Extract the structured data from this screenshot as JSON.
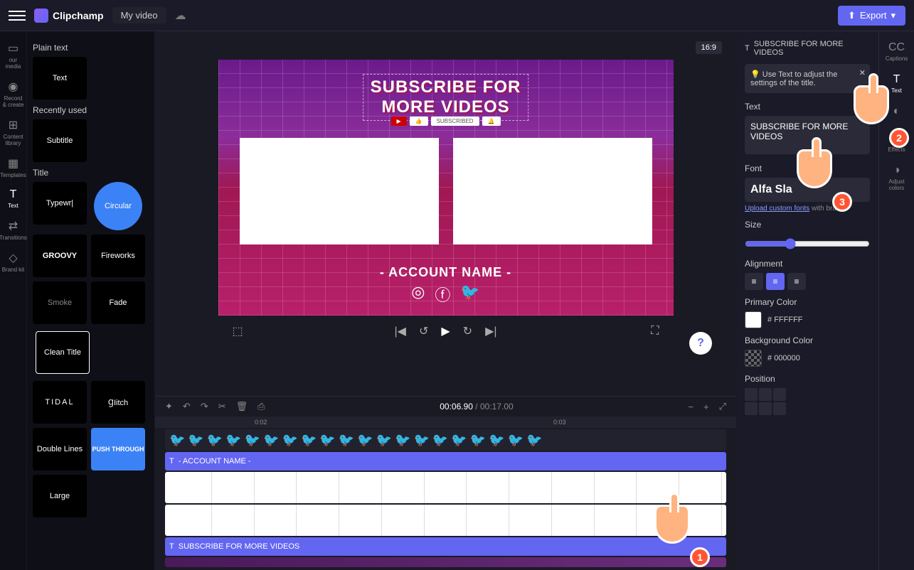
{
  "topbar": {
    "brand": "Clipchamp",
    "video_title": "My video",
    "export": "Export"
  },
  "left_rail": [
    {
      "label": "our media"
    },
    {
      "label": "Record & create"
    },
    {
      "label": "Content library"
    },
    {
      "label": "Templates"
    },
    {
      "label": "Text"
    },
    {
      "label": "Transitions"
    },
    {
      "label": "Brand kit"
    }
  ],
  "text_panel": {
    "sections": {
      "plain": "Plain text",
      "recent": "Recently used",
      "title": "Title"
    },
    "tiles": {
      "text": "Text",
      "subtitle": "Subtitle",
      "typewriter": "Typewr|",
      "circular": "Circular",
      "groovy": "GROOVY",
      "fireworks": "Fireworks",
      "smoke": "Smoke",
      "fade": "Fade",
      "clean": "Clean Title",
      "tidal": "TIDAL",
      "glitch": "ꞬIitch",
      "double": "Double Lines",
      "push": "PUSH THROUGH",
      "large": "Large"
    }
  },
  "preview": {
    "aspect": "16:9",
    "title": "SUBSCRIBE FOR\nMORE VIDEOS",
    "subscribed": "SUBSCRIBED",
    "account": "- ACCOUNT NAME -"
  },
  "player": {
    "current_time": "00:06.90",
    "total_time": "00:17.00",
    "sep": " / "
  },
  "timeline": {
    "marks": {
      "m1": "0:02",
      "m2": "0:03"
    },
    "track_account": "- ACCOUNT NAME -",
    "track_subscribe": "SUBSCRIBE FOR MORE VIDEOS"
  },
  "right_panel": {
    "header": "SUBSCRIBE FOR MORE VIDEOS",
    "tip": "Use Text to adjust the settings of the title.",
    "labels": {
      "text": "Text",
      "font": "Font",
      "upload_fonts": "Upload custom fonts",
      "upload_suffix": " with bran...",
      "size": "Size",
      "alignment": "Alignment",
      "primary": "Primary Color",
      "background": "Background Color",
      "position": "Position"
    },
    "text_value": "SUBSCRIBE FOR MORE VIDEOS",
    "font_name": "Alfa Sla",
    "primary_hex": "FFFFFF",
    "bg_hex": "000000"
  },
  "right_rail": [
    {
      "label": "Captions"
    },
    {
      "label": "Text"
    },
    {
      "label": ""
    },
    {
      "label": "Effects"
    },
    {
      "label": "Adjust colors"
    }
  ],
  "help": "?",
  "cursors": {
    "c1": "1",
    "c2": "2",
    "c3": "3"
  }
}
